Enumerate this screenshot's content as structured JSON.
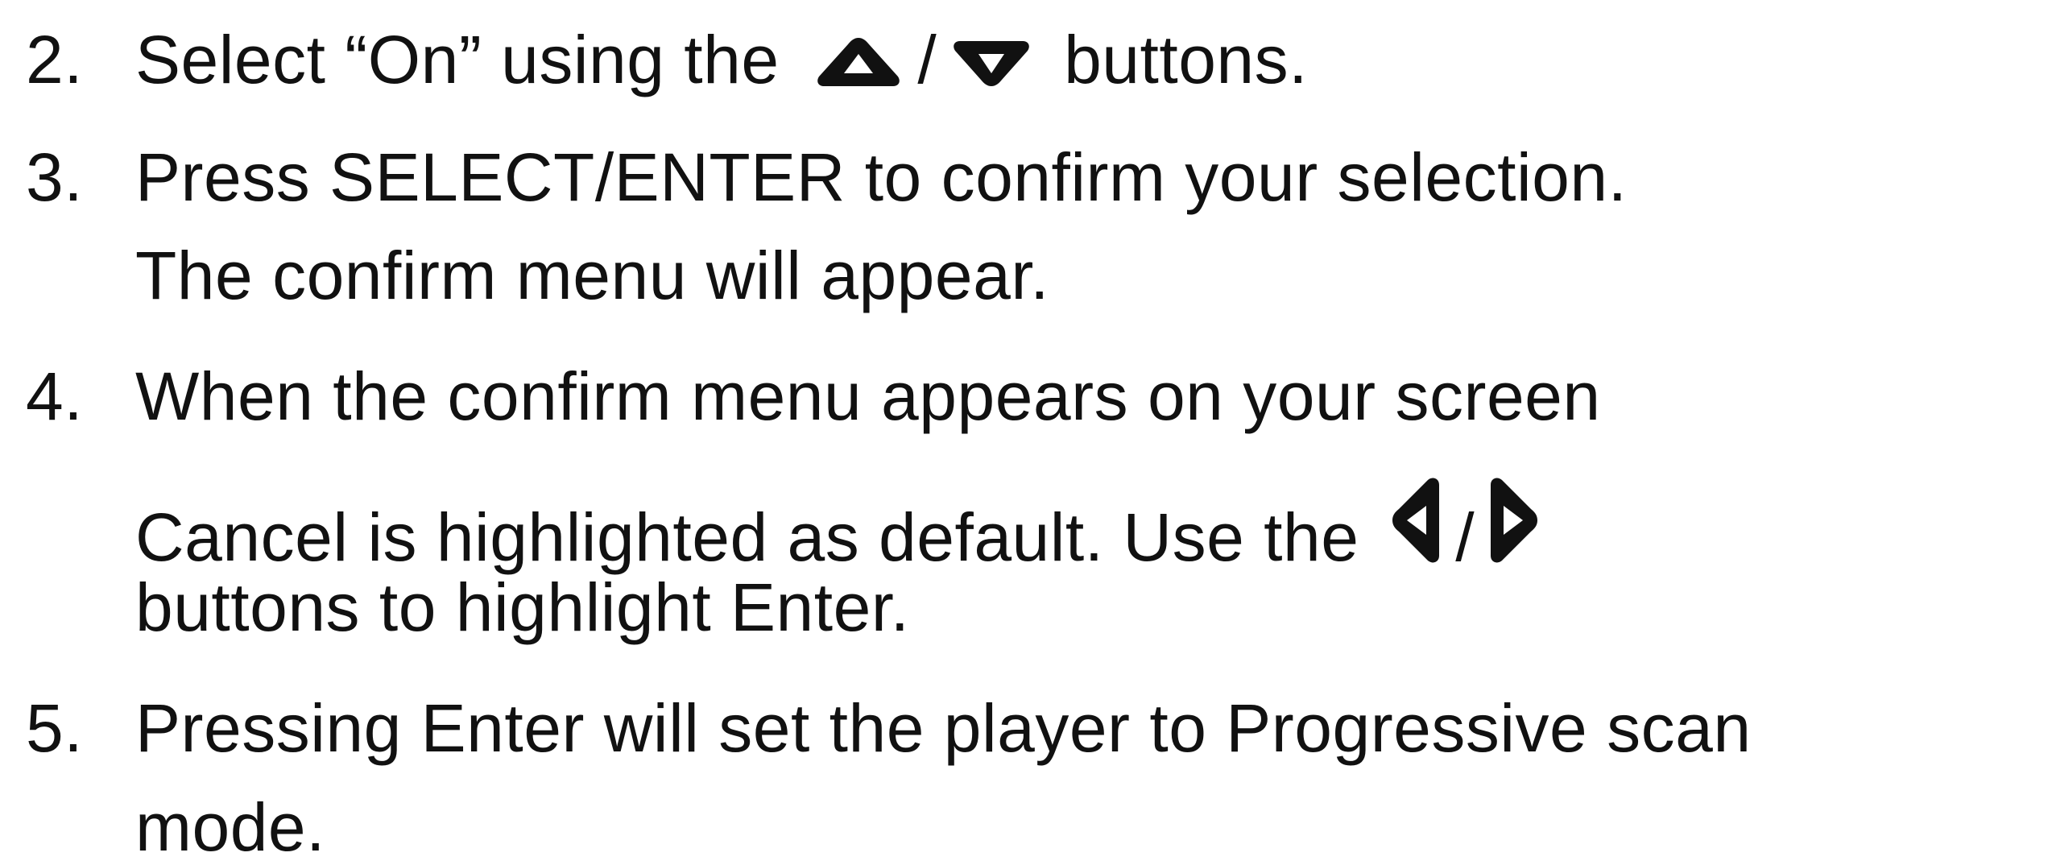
{
  "steps": [
    {
      "number": "2.",
      "line1_before": "Select “On” using the",
      "separator": "/",
      "line1_after": "buttons.",
      "icons": [
        "arrow-up-icon",
        "arrow-down-icon"
      ]
    },
    {
      "number": "3.",
      "line1": "Press SELECT/ENTER to confirm your selection.",
      "line2": "The confirm menu will appear."
    },
    {
      "number": "4.",
      "line1": "When the confirm menu appears on your screen",
      "line2_before": "Cancel is highlighted as default. Use the",
      "separator": "/",
      "line3": "buttons to highlight Enter.",
      "icons": [
        "arrow-left-icon",
        "arrow-right-icon"
      ]
    },
    {
      "number": "5.",
      "line1": "Pressing Enter will set the player to Progressive scan",
      "line2": "mode."
    }
  ],
  "colors": {
    "text": "#111111",
    "background": "#ffffff"
  }
}
